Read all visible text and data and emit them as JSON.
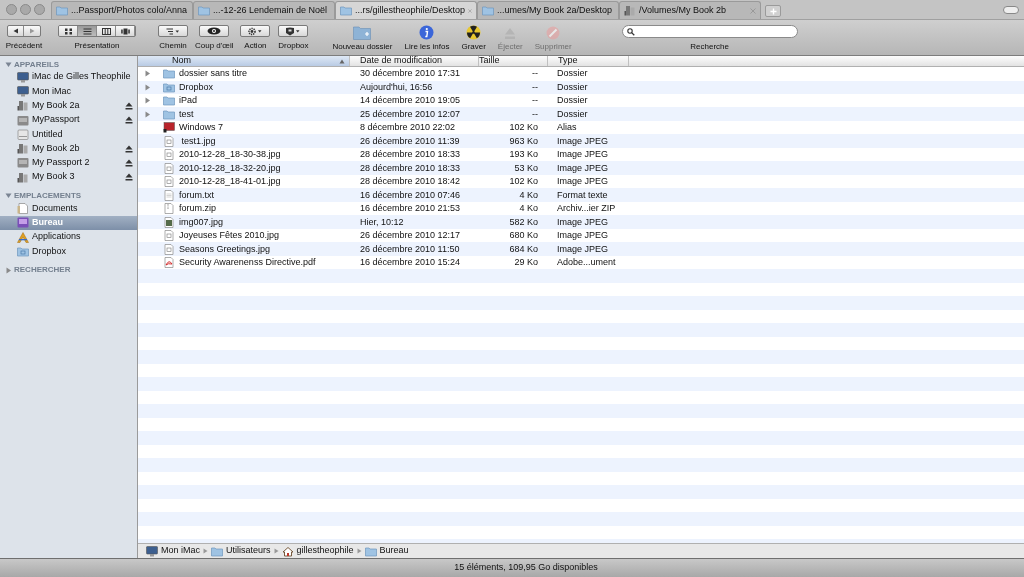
{
  "window": {
    "tabs": [
      {
        "label": "...Passport/Photos colo/Anna",
        "kind": "folder",
        "selected": false
      },
      {
        "label": "...-12-26 Lendemain de Noël",
        "kind": "folder",
        "selected": false
      },
      {
        "label": "...rs/gillestheophile/Desktop",
        "kind": "folder",
        "selected": true
      },
      {
        "label": "...umes/My Book 2a/Desktop",
        "kind": "folder",
        "selected": false
      },
      {
        "label": "/Volumes/My Book 2b",
        "kind": "drive",
        "selected": false
      }
    ]
  },
  "toolbar": {
    "back": {
      "label": "Précédent"
    },
    "view": {
      "label": "Présentation",
      "modes": [
        {
          "kind": "icons",
          "selected": false
        },
        {
          "kind": "list",
          "selected": true
        },
        {
          "kind": "columns",
          "selected": false
        },
        {
          "kind": "coverflow",
          "selected": false
        }
      ]
    },
    "menu_buttons": [
      {
        "kind": "path",
        "label": "Chemin"
      },
      {
        "kind": "eye",
        "label": "Coup d'œil"
      },
      {
        "kind": "gear",
        "label": "Action"
      },
      {
        "kind": "dropbox",
        "label": "Dropbox"
      }
    ],
    "buttons": [
      {
        "kind": "new-folder",
        "label": "Nouveau dossier",
        "disabled": false
      },
      {
        "kind": "info",
        "label": "Lire les infos",
        "disabled": false
      },
      {
        "kind": "burn",
        "label": "Graver",
        "disabled": false
      },
      {
        "kind": "eject",
        "label": "Éjecter",
        "disabled": true
      },
      {
        "kind": "delete",
        "label": "Supprimer",
        "disabled": true
      }
    ],
    "search": {
      "label": "Recherche"
    }
  },
  "sidebar": {
    "sections": [
      {
        "title": "APPAREILS",
        "expanded": true,
        "items": [
          {
            "label": "iMac de Gilles Theophile",
            "kind": "imac",
            "eject": false,
            "selected": false
          },
          {
            "label": "Mon iMac",
            "kind": "imac",
            "eject": false,
            "selected": false
          },
          {
            "label": "My Book 2a",
            "kind": "drive",
            "eject": true,
            "selected": false
          },
          {
            "label": "MyPassport",
            "kind": "disk",
            "eject": true,
            "selected": false
          },
          {
            "label": "Untitled",
            "kind": "volume",
            "eject": false,
            "selected": false
          },
          {
            "label": "My Book 2b",
            "kind": "drive",
            "eject": true,
            "selected": false
          },
          {
            "label": "My Passport 2",
            "kind": "disk",
            "eject": true,
            "selected": false
          },
          {
            "label": "My Book 3",
            "kind": "drive",
            "eject": true,
            "selected": false
          }
        ]
      },
      {
        "title": "EMPLACEMENTS",
        "expanded": true,
        "items": [
          {
            "label": "Documents",
            "kind": "documents",
            "eject": false,
            "selected": false
          },
          {
            "label": "Bureau",
            "kind": "desktop",
            "eject": false,
            "selected": true
          },
          {
            "label": "Applications",
            "kind": "applications",
            "eject": false,
            "selected": false
          },
          {
            "label": "Dropbox",
            "kind": "dropbox-folder",
            "eject": false,
            "selected": false
          }
        ]
      },
      {
        "title": "RECHERCHER",
        "expanded": false
      }
    ]
  },
  "file_list": {
    "columns": [
      {
        "label": "Nom",
        "sorted": true
      },
      {
        "label": "Date de modification",
        "sorted": false
      },
      {
        "label": "Taille",
        "sorted": false
      },
      {
        "label": "Type",
        "sorted": false
      }
    ],
    "rows": [
      {
        "name": "dossier sans titre",
        "date": "30 décembre 2010 17:31",
        "size": "--",
        "type": "Dossier",
        "kind": "folder",
        "expandable": true
      },
      {
        "name": "Dropbox",
        "date": "Aujourd'hui, 16:56",
        "size": "--",
        "type": "Dossier",
        "kind": "dropbox-folder",
        "expandable": true
      },
      {
        "name": "iPad",
        "date": "14 décembre 2010 19:05",
        "size": "--",
        "type": "Dossier",
        "kind": "folder",
        "expandable": true
      },
      {
        "name": "test",
        "date": "25 décembre 2010 12:07",
        "size": "--",
        "type": "Dossier",
        "kind": "folder",
        "expandable": true
      },
      {
        "name": "Windows 7",
        "date": "8 décembre 2010 22:02",
        "size": "102 Ko",
        "type": "Alias",
        "kind": "alias",
        "expandable": false
      },
      {
        "name": " test1.jpg",
        "date": "26 décembre 2010 11:39",
        "size": "963 Ko",
        "type": "Image JPEG",
        "kind": "image",
        "expandable": false
      },
      {
        "name": "2010-12-28_18-30-38.jpg",
        "date": "28 décembre 2010 18:33",
        "size": "193 Ko",
        "type": "Image JPEG",
        "kind": "image",
        "expandable": false
      },
      {
        "name": "2010-12-28_18-32-20.jpg",
        "date": "28 décembre 2010 18:33",
        "size": "53 Ko",
        "type": "Image JPEG",
        "kind": "image",
        "expandable": false
      },
      {
        "name": "2010-12-28_18-41-01.jpg",
        "date": "28 décembre 2010 18:42",
        "size": "102 Ko",
        "type": "Image JPEG",
        "kind": "image",
        "expandable": false
      },
      {
        "name": "forum.txt",
        "date": "16 décembre 2010 07:46",
        "size": "4 Ko",
        "type": "Format texte",
        "kind": "text",
        "expandable": false
      },
      {
        "name": "forum.zip",
        "date": "16 décembre 2010 21:53",
        "size": "4 Ko",
        "type": "Archiv...ier ZIP",
        "kind": "zip",
        "expandable": false
      },
      {
        "name": "img007.jpg",
        "date": "Hier, 10:12",
        "size": "582 Ko",
        "type": "Image JPEG",
        "kind": "photo",
        "expandable": false
      },
      {
        "name": "Joyeuses Fêtes 2010.jpg",
        "date": "26 décembre 2010 12:17",
        "size": "680 Ko",
        "type": "Image JPEG",
        "kind": "image",
        "expandable": false
      },
      {
        "name": "Seasons Greetings.jpg",
        "date": "26 décembre 2010 11:50",
        "size": "684 Ko",
        "type": "Image JPEG",
        "kind": "image",
        "expandable": false
      },
      {
        "name": "Security Awarenenss Directive.pdf",
        "date": "16 décembre 2010 15:24",
        "size": "29 Ko",
        "type": "Adobe...ument",
        "kind": "pdf",
        "expandable": false
      }
    ]
  },
  "path_bar": [
    {
      "label": "Mon iMac",
      "kind": "imac"
    },
    {
      "label": "Utilisateurs",
      "kind": "folder"
    },
    {
      "label": "gillestheophile",
      "kind": "home"
    },
    {
      "label": "Bureau",
      "kind": "folder"
    }
  ],
  "status_bar": {
    "text": "15 éléments, 109,95 Go disponibles"
  }
}
